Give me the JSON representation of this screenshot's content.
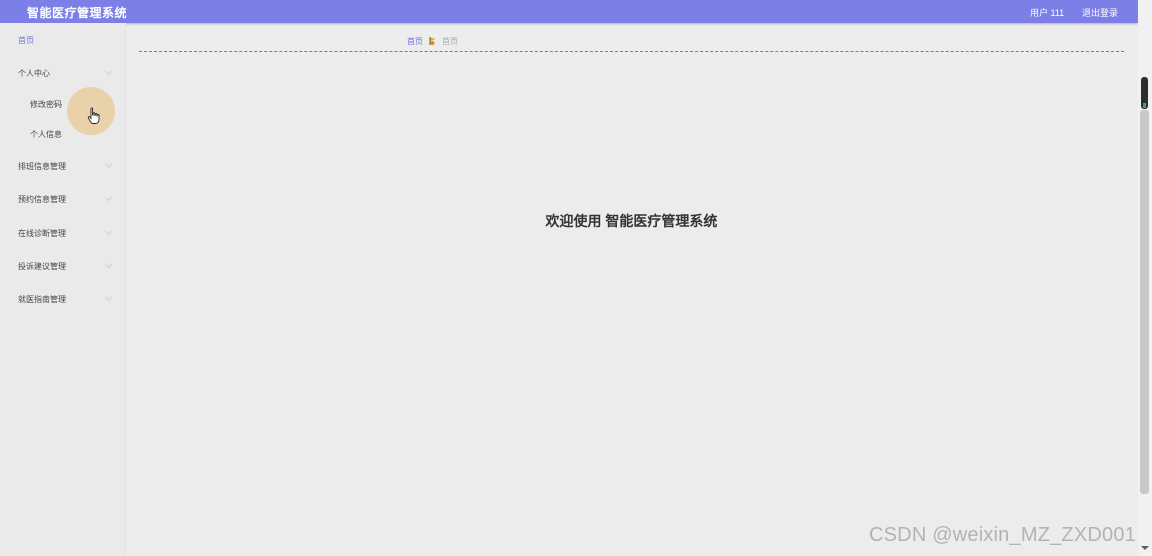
{
  "header": {
    "title": "智能医疗管理系统",
    "user_label": "用户 111",
    "logout_label": "退出登录",
    "background_color": "#7b7fe6"
  },
  "sidebar": {
    "items": [
      {
        "label": "首页"
      },
      {
        "label": "个人中心"
      },
      {
        "label": "修改密码"
      },
      {
        "label": "个人信息"
      },
      {
        "label": "排班信息管理"
      },
      {
        "label": "预约信息管理"
      },
      {
        "label": "在线诊断管理"
      },
      {
        "label": "投诉建议管理"
      },
      {
        "label": "就医指南管理"
      }
    ]
  },
  "breadcrumb": {
    "home": "首页",
    "separator_icon": "flag-icon",
    "current": "首页"
  },
  "main": {
    "welcome_text": "欢迎使用 智能医疗管理系统"
  },
  "watermark": "CSDN @weixin_MZ_ZXD001",
  "colors": {
    "accent": "#6f73e0",
    "click_highlight": "#e9c183"
  }
}
